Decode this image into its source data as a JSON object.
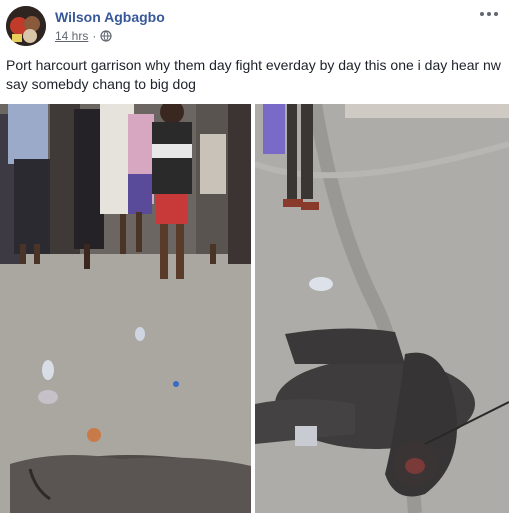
{
  "post": {
    "author": "Wilson Agbagbo",
    "time": "14 hrs",
    "separator": "·",
    "privacy_icon": "globe-icon",
    "more_icon": "more-options-icon",
    "text": "Port harcourt garrison why them day fight everday by day this one i day hear nw say somebdy chang to big dog"
  },
  "photos": [
    {
      "name": "crowd-and-dog-photo"
    },
    {
      "name": "dog-on-road-photo"
    }
  ],
  "colors": {
    "author_link": "#385898",
    "meta_gray": "#616770",
    "text": "#1d2129"
  }
}
